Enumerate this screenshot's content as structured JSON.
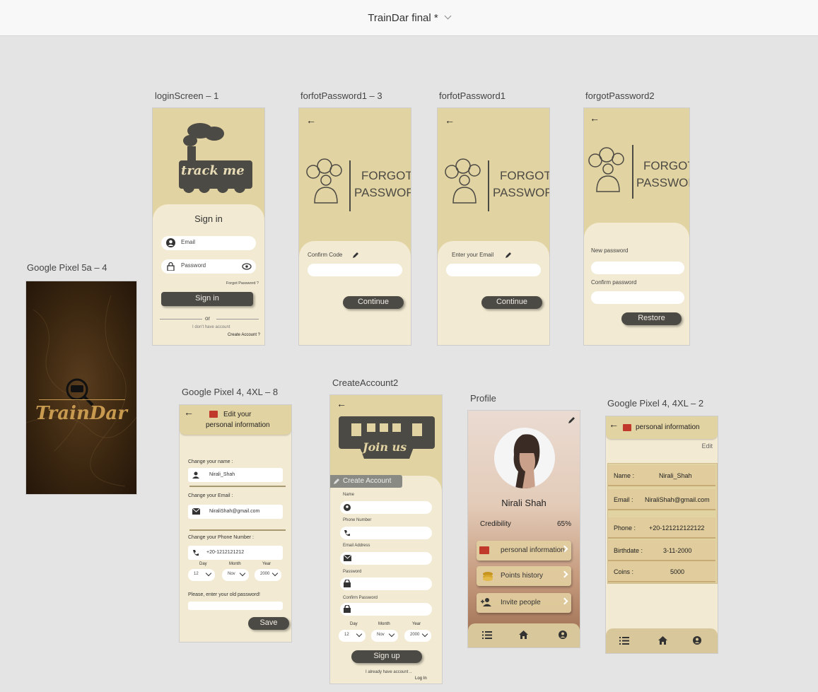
{
  "app": {
    "document_title": "TrainDar final *"
  },
  "artboards": {
    "splash": {
      "label": "Google Pixel 5a – 4",
      "brand": "TrainDar"
    },
    "login": {
      "label": "loginScreen – 1",
      "logo_text": "track me",
      "heading": "Sign in",
      "email_placeholder": "Email",
      "password_placeholder": "Password",
      "forgot_link": "Forgot Password ?",
      "sign_in_button": "Sign in",
      "or_text": "or",
      "no_account_text": "I don't have account",
      "create_account_link": "Create Account ?"
    },
    "forgot_confirm": {
      "label": "forfotPassword1 – 3",
      "graphic_line1": "FORGOT",
      "graphic_line2": "PASSWORD",
      "field_label": "Confirm Code",
      "button": "Continue"
    },
    "forgot_email": {
      "label": "forfotPassword1",
      "graphic_line1": "FORGOT",
      "graphic_line2": "PASSWORD",
      "field_label": "Enter your Email",
      "button": "Continue"
    },
    "forgot_reset": {
      "label": "forgotPassword2",
      "graphic_line1": "FORGOT",
      "graphic_line2": "PASSWORD",
      "new_password_label": "New password",
      "confirm_password_label": "Confirm password",
      "button": "Restore"
    },
    "edit_info": {
      "label": "Google Pixel 4, 4XL – 8",
      "header_line1": "Edit your",
      "header_line2": "personal information",
      "name_label": "Change your name :",
      "name_value": "Nirali_Shah",
      "email_label": "Change your Email :",
      "email_value": "NiraliShah@gmail.com",
      "phone_label": "Change your Phone Number :",
      "phone_value": "+20-1212121212",
      "day_label": "Day",
      "month_label": "Month",
      "year_label": "Year",
      "day_value": "12",
      "month_value": "Nov",
      "year_value": "2000",
      "old_password_label": "Please, enter your old password!",
      "save_button": "Save"
    },
    "create_account": {
      "label": "CreateAccount2",
      "banner_text": "Join us",
      "tab_label": "Create Account",
      "name_label": "Name",
      "phone_label": "Phone Number",
      "email_label": "Email Address",
      "password_label": "Password",
      "confirm_label": "Confirm Password",
      "day_label": "Day",
      "month_label": "Month",
      "year_label": "Year",
      "day_value": "12",
      "month_value": "Nov",
      "year_value": "2000",
      "signup_button": "Sign up",
      "already_text": "I already have account ..",
      "login_link": "Log In"
    },
    "profile": {
      "label": "Profile",
      "name": "Nirali Shah",
      "credibility_label": "Credibility",
      "credibility_value": "65%",
      "buttons": [
        "personal information",
        "Points history",
        "Invite people"
      ]
    },
    "personal_info": {
      "label": "Google Pixel 4, 4XL – 2",
      "header": "personal information",
      "edit_link": "Edit",
      "rows": [
        {
          "key": "Name :",
          "value": "Nirali_Shah"
        },
        {
          "key": "Email :",
          "value": "NiraliShah@gmail.com"
        },
        {
          "key": "Phone :",
          "value": "+20-121212122122"
        },
        {
          "key": "Birthdate :",
          "value": "3-11-2000"
        },
        {
          "key": "Coins :",
          "value": "5000"
        }
      ]
    }
  },
  "colors": {
    "beige": "#f2ead2",
    "tan": "#e2d3a2",
    "dark": "#4c4a44",
    "brown": "#3d2a14",
    "gold": "#c89a50"
  }
}
